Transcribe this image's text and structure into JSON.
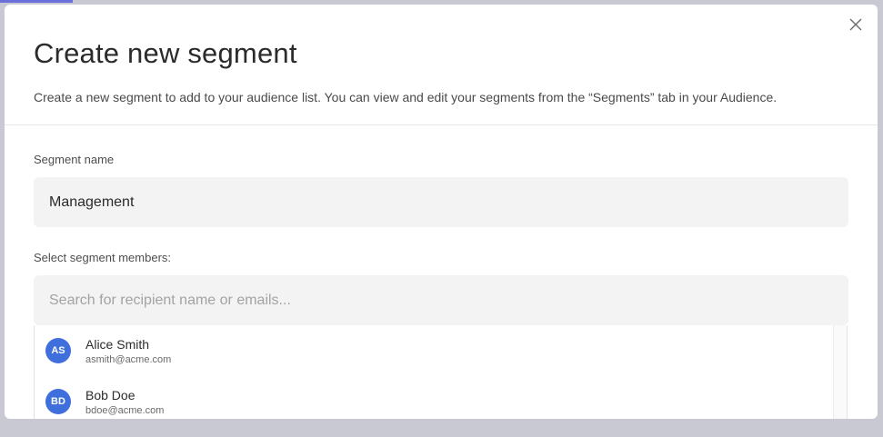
{
  "modal": {
    "title": "Create new segment",
    "subtitle": "Create a new segment to add to your audience list. You can view and edit your segments from the “Segments” tab in your Audience.",
    "close_icon": "close-icon"
  },
  "segment_name": {
    "label": "Segment name",
    "value": "Management"
  },
  "members": {
    "label": "Select segment members:",
    "search_placeholder": "Search for recipient name or emails...",
    "items": [
      {
        "initials": "AS",
        "name": "Alice Smith",
        "email": "asmith@acme.com"
      },
      {
        "initials": "BD",
        "name": "Bob Doe",
        "email": "bdoe@acme.com"
      }
    ]
  },
  "colors": {
    "avatar": "#3e6fdc",
    "backdrop": "#c9c9d3"
  }
}
